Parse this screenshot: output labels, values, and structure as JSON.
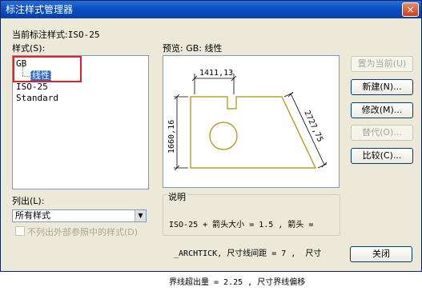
{
  "window": {
    "title": "标注样式管理器",
    "close_glyph": "×"
  },
  "current_style": {
    "label": "当前标注样式:",
    "value": "ISO-25"
  },
  "styles": {
    "label": "样式(S):",
    "items": [
      "GB",
      "线性",
      "ISO-25",
      "Standard"
    ]
  },
  "preview": {
    "label": "预览: GB: 线性",
    "dim_top": "1411,13",
    "dim_left": "1660,16",
    "dim_right": "2727,75"
  },
  "description": {
    "label": "说明",
    "lines": [
      "ISO-25 + 箭头大小 = 1.5 , 箭头 =",
      " _ARCHTICK, 尺寸线间距 = 7 ,  尺寸",
      "界线超出量 = 2.25 , 尺寸界线偏移"
    ]
  },
  "list_filter": {
    "label": "列出(L):",
    "value": "所有样式",
    "arrow_glyph": "▼"
  },
  "xref_checkbox": {
    "label": "不列出外部参照中的样式(D)"
  },
  "buttons": {
    "set_current": "置为当前(U)",
    "new": "新建(N)...",
    "modify": "修改(M)...",
    "override": "替代(O)...",
    "compare": "比较(C)...",
    "close": "关闭"
  },
  "colors": {
    "title_bar": "#0a4fc0",
    "selection": "#316ac5",
    "highlight_frame": "#e2202b",
    "drawing": "#b38b00"
  }
}
